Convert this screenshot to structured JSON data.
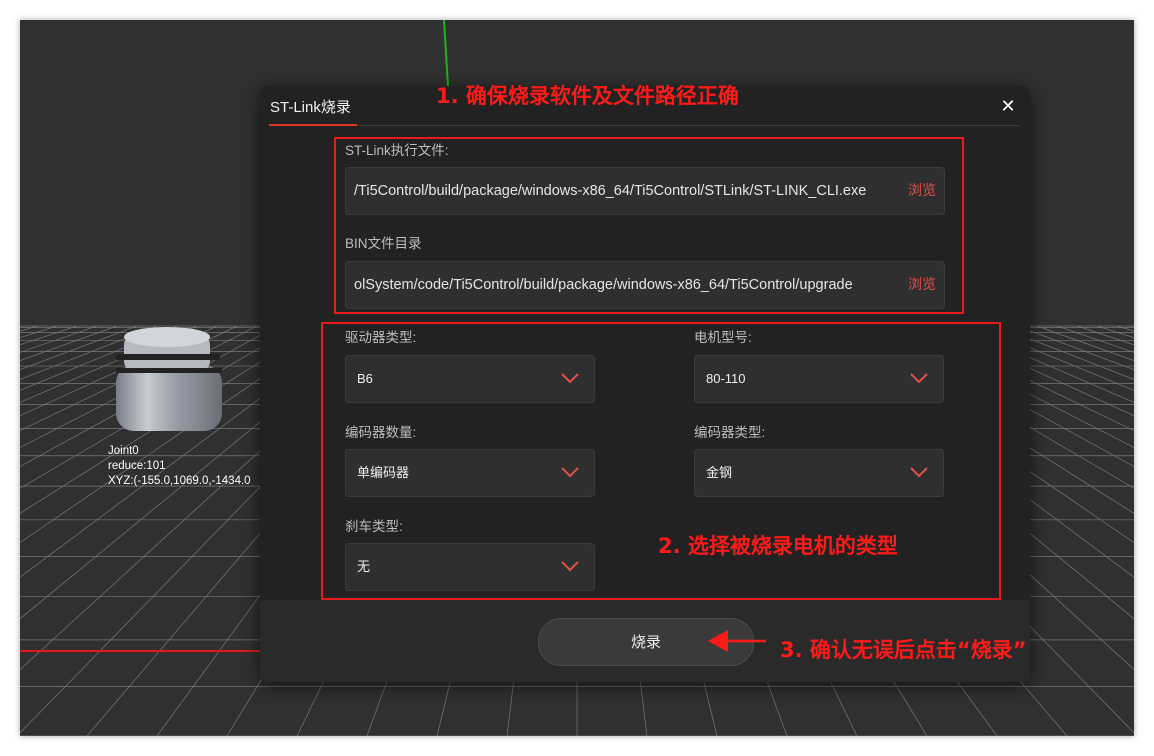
{
  "viewport": {
    "object_label": {
      "name": "Joint0",
      "reduce": "reduce:101",
      "xyz": "XYZ:(-155.0,1069.0,-1434.0"
    }
  },
  "dialog": {
    "title": "ST-Link烧录",
    "close_symbol": "✕",
    "stlink_label": "ST-Link执行文件:",
    "stlink_path": "/Ti5Control/build/package/windows-x86_64/Ti5Control/STLink/ST-LINK_CLI.exe",
    "bin_label": "BIN文件目录",
    "bin_path": "olSystem/code/Ti5Control/build/package/windows-x86_64/Ti5Control/upgrade",
    "browse_label": "浏览",
    "driver_type": {
      "label": "驱动器类型:",
      "value": "B6"
    },
    "motor_model": {
      "label": "电机型号:",
      "value": "80-110"
    },
    "encoder_count": {
      "label": "编码器数量:",
      "value": "单编码器"
    },
    "encoder_type": {
      "label": "编码器类型:",
      "value": "金钢"
    },
    "brake_type": {
      "label": "刹车类型:",
      "value": "无"
    },
    "burn_button": "烧录"
  },
  "annotations": {
    "step1": "1. 确保烧录软件及文件路径正确",
    "step2": "2. 选择被烧录电机的类型",
    "step3": "3. 确认无误后点击“烧录”"
  },
  "colors": {
    "annotation": "#ff1a1a",
    "browse": "#e0514b",
    "title_accent": "#e0352b",
    "dialog_bg": "#222222"
  },
  "icons": {
    "dropdown": "chevron-down-icon",
    "close": "close-icon"
  }
}
